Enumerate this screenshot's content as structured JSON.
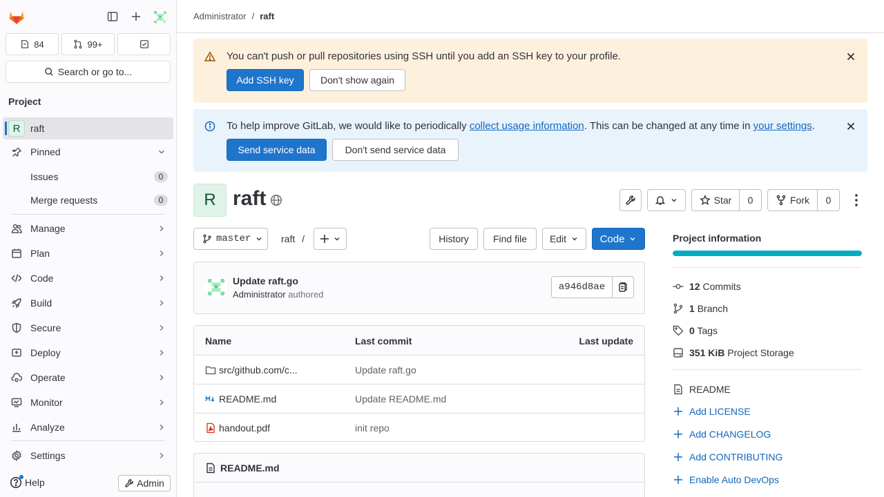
{
  "sidebar": {
    "counts": {
      "issues": "84",
      "merge_requests": "99+"
    },
    "search_label": "Search or go to...",
    "section_title": "Project",
    "project": {
      "initial": "R",
      "name": "raft"
    },
    "pinned": {
      "label": "Pinned",
      "items": [
        {
          "label": "Issues",
          "count": "0"
        },
        {
          "label": "Merge requests",
          "count": "0"
        }
      ]
    },
    "nav": [
      {
        "label": "Manage",
        "icon": "users-icon"
      },
      {
        "label": "Plan",
        "icon": "calendar-icon"
      },
      {
        "label": "Code",
        "icon": "code-icon"
      },
      {
        "label": "Build",
        "icon": "rocket-icon"
      },
      {
        "label": "Secure",
        "icon": "shield-icon"
      },
      {
        "label": "Deploy",
        "icon": "deploy-icon"
      },
      {
        "label": "Operate",
        "icon": "cloud-gear-icon"
      },
      {
        "label": "Monitor",
        "icon": "monitor-icon"
      },
      {
        "label": "Analyze",
        "icon": "chart-icon"
      },
      {
        "label": "Settings",
        "icon": "gear-icon"
      }
    ],
    "help_label": "Help",
    "admin_label": "Admin"
  },
  "breadcrumb": {
    "parent": "Administrator",
    "separator": "/",
    "current": "raft"
  },
  "alerts": {
    "ssh": {
      "text": "You can't push or pull repositories using SSH until you add an SSH key to your profile.",
      "primary": "Add SSH key",
      "secondary": "Don't show again"
    },
    "usage": {
      "text_before": "To help improve GitLab, we would like to periodically ",
      "link1": "collect usage information",
      "text_middle": ". This can be changed at any time in ",
      "link2": "your settings",
      "text_after": ".",
      "primary": "Send service data",
      "secondary": "Don't send service data"
    }
  },
  "project": {
    "initial": "R",
    "name": "raft",
    "star_label": "Star",
    "star_count": "0",
    "fork_label": "Fork",
    "fork_count": "0"
  },
  "repo": {
    "branch": "master",
    "path": "raft",
    "path_sep": "/",
    "history": "History",
    "find_file": "Find file",
    "edit": "Edit",
    "code": "Code"
  },
  "commit": {
    "title": "Update raft.go",
    "author": "Administrator",
    "action": "authored",
    "sha": "a946d8ae"
  },
  "files": {
    "headers": {
      "name": "Name",
      "last_commit": "Last commit",
      "last_update": "Last update"
    },
    "rows": [
      {
        "name": "src/github.com/c...",
        "commit": "Update raft.go",
        "icon": "folder-icon"
      },
      {
        "name": "README.md",
        "commit": "Update README.md",
        "icon": "markdown-icon"
      },
      {
        "name": "handout.pdf",
        "commit": "init repo",
        "icon": "pdf-icon"
      }
    ]
  },
  "readme": {
    "title": "README.md"
  },
  "info": {
    "title": "Project information",
    "progress": 1.0,
    "commits": {
      "count": "12",
      "label": "Commits"
    },
    "branches": {
      "count": "1",
      "label": "Branch"
    },
    "tags": {
      "count": "0",
      "label": "Tags"
    },
    "storage": {
      "count": "351 KiB",
      "label": "Project Storage"
    },
    "readme": "README",
    "add_links": [
      "Add LICENSE",
      "Add CHANGELOG",
      "Add CONTRIBUTING",
      "Enable Auto DevOps"
    ]
  },
  "colors": {
    "primary": "#1f75cb",
    "warning_bg": "#fdf1dd",
    "info_bg": "#e9f3fc",
    "progress": "#00acc1"
  }
}
